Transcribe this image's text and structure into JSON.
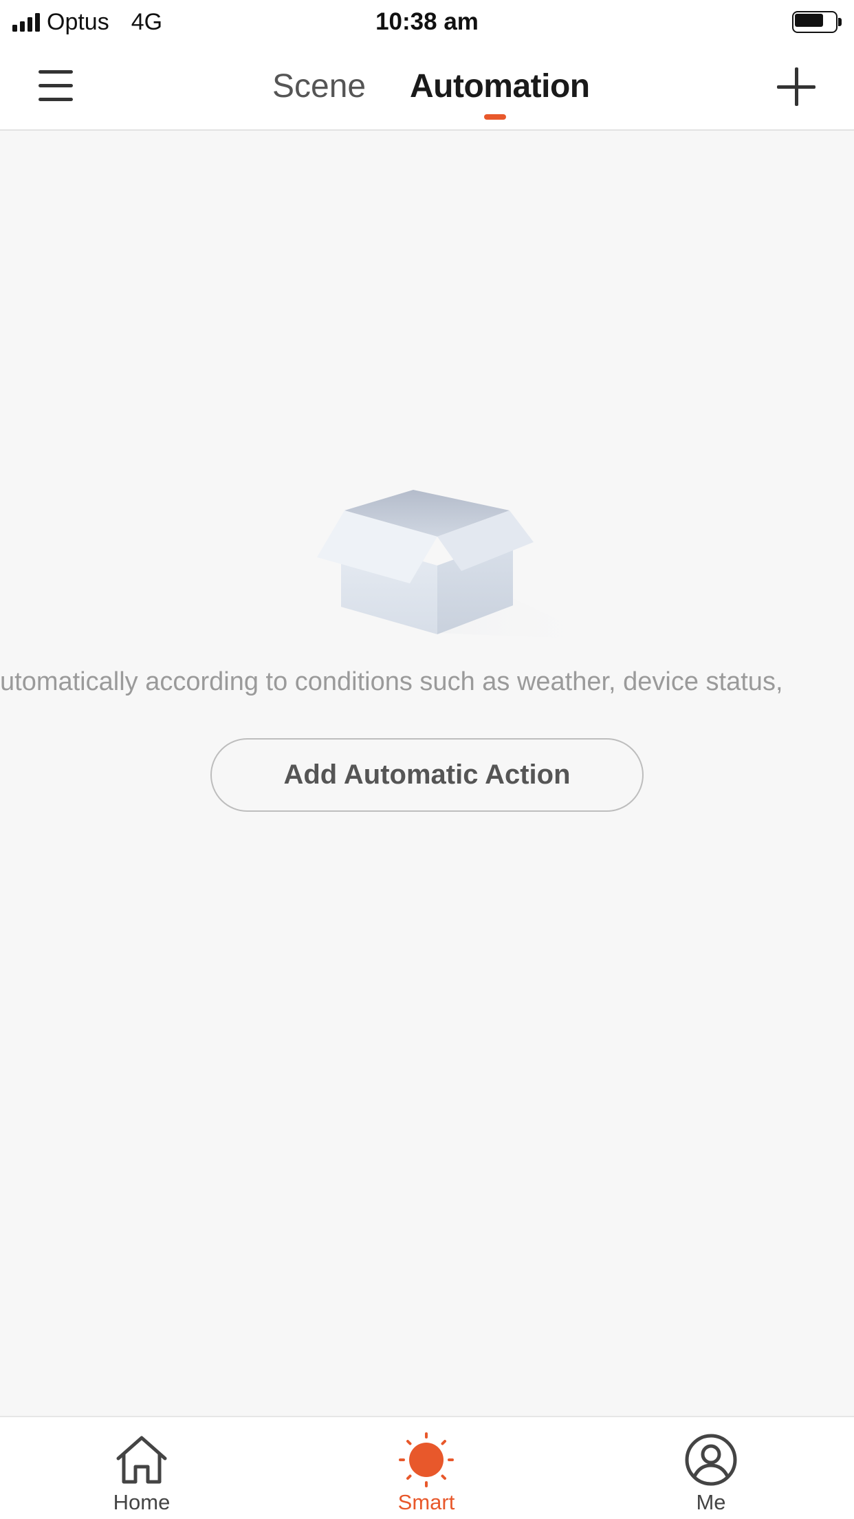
{
  "status_bar": {
    "carrier": "Optus",
    "network": "4G",
    "time": "10:38 am",
    "battery_level": 0.7
  },
  "header": {
    "menu_icon": "hamburger-menu-icon",
    "tabs": [
      {
        "label": "Scene",
        "active": false
      },
      {
        "label": "Automation",
        "active": true
      }
    ],
    "add_icon": "plus-icon"
  },
  "empty_state": {
    "illustration": "empty-box",
    "message": "utomatically according to conditions such as weather, device status,",
    "button_label": "Add Automatic Action"
  },
  "tab_bar": {
    "items": [
      {
        "label": "Home",
        "icon": "home-icon",
        "active": false
      },
      {
        "label": "Smart",
        "icon": "sun-icon",
        "active": true
      },
      {
        "label": "Me",
        "icon": "user-icon",
        "active": false
      }
    ]
  },
  "colors": {
    "accent": "#e8582b",
    "background": "#f7f7f7",
    "text_primary": "#1a1a1a",
    "text_secondary": "#9a9a9a"
  }
}
